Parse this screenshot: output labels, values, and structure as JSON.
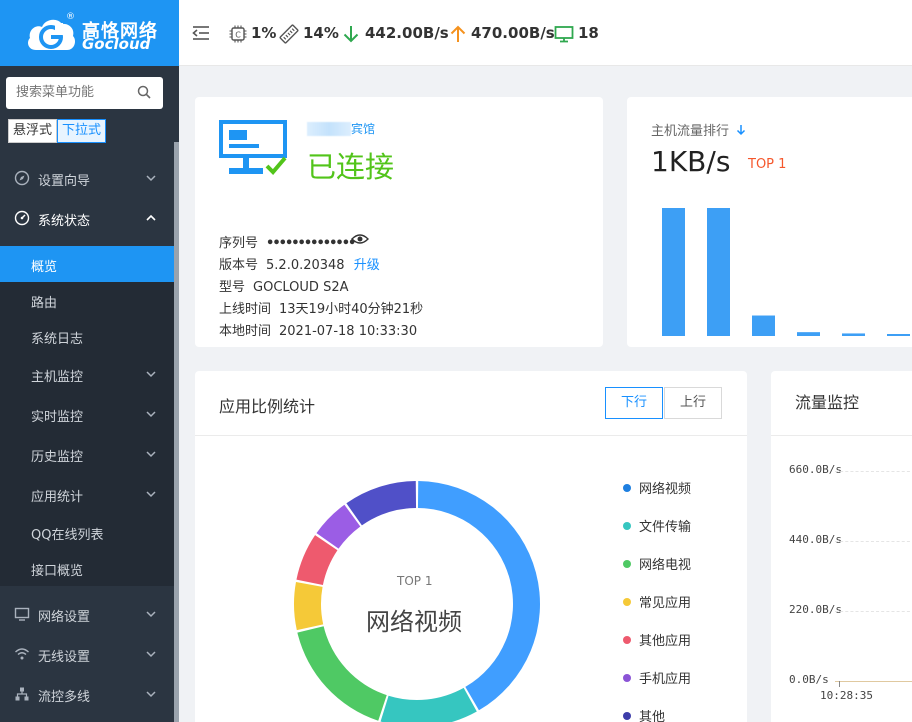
{
  "brand": {
    "name_cn": "高恪网络",
    "name_en": "Gocloud",
    "reg": "®"
  },
  "search": {
    "placeholder": "搜索菜单功能"
  },
  "menu_mode": {
    "float": "悬浮式",
    "dropdown": "下拉式"
  },
  "nav": {
    "setup": "设置向导",
    "status": "系统状态",
    "status_children": [
      "概览",
      "路由",
      "系统日志",
      "主机监控",
      "实时监控",
      "历史监控",
      "应用统计",
      "QQ在线列表",
      "接口概览"
    ],
    "network": "网络设置",
    "wireless": "无线设置",
    "flowctrl": "流控多线"
  },
  "topbar": {
    "cpu": "1%",
    "mem": "14%",
    "down": "442.00B/s",
    "up": "470.00B/s",
    "hosts": "18"
  },
  "device": {
    "name_suffix": "宾馆",
    "status": "已连接",
    "serial_label": "序列号",
    "serial_value": "••••••••••••••",
    "version_label": "版本号",
    "version_value": "5.2.0.20348",
    "upgrade": "升级",
    "model_label": "型号",
    "model_value": "GOCLOUD S2A",
    "uptime_label": "上线时间",
    "uptime_value": "13天19小时40分钟21秒",
    "localtime_label": "本地时间",
    "localtime_value": "2021-07-18 10:33:30"
  },
  "host_rank": {
    "title": "主机流量排行",
    "value": "1KB/s",
    "top_label": "TOP 1",
    "bars": [
      1.0,
      1.0,
      0.16,
      0.03,
      0.02,
      0.015
    ],
    "bar_color": "#3d9ff5"
  },
  "app_stats": {
    "title": "应用比例统计",
    "tab_down": "下行",
    "tab_up": "上行",
    "center_top": "TOP 1",
    "center_name": "网络视频",
    "legend": [
      {
        "name": "网络视频",
        "color": "#1e7fe0"
      },
      {
        "name": "文件传输",
        "color": "#36c6c0"
      },
      {
        "name": "网络电视",
        "color": "#4fc964"
      },
      {
        "name": "常见应用",
        "color": "#f5c938"
      },
      {
        "name": "其他应用",
        "color": "#ee5a6e"
      },
      {
        "name": "手机应用",
        "color": "#8b54d6"
      },
      {
        "name": "其他",
        "color": "#3d3daa"
      }
    ],
    "slices": [
      {
        "name": "网络视频",
        "value": 38,
        "color": "#409eff"
      },
      {
        "name": "文件传输",
        "value": 12,
        "color": "#36c6c0"
      },
      {
        "name": "网络电视",
        "value": 15,
        "color": "#4fc964"
      },
      {
        "name": "常见应用",
        "value": 6,
        "color": "#f5c938"
      },
      {
        "name": "其他应用",
        "value": 6,
        "color": "#ee5a6e"
      },
      {
        "name": "手机应用",
        "value": 5,
        "color": "#9b5de5"
      },
      {
        "name": "其他",
        "value": 9,
        "color": "#5050c8"
      }
    ]
  },
  "traffic": {
    "title": "流量监控",
    "yticks": [
      "660.0B/s",
      "440.0B/s",
      "220.0B/s",
      "0.0B/s"
    ],
    "xtick": "10:28:35"
  }
}
